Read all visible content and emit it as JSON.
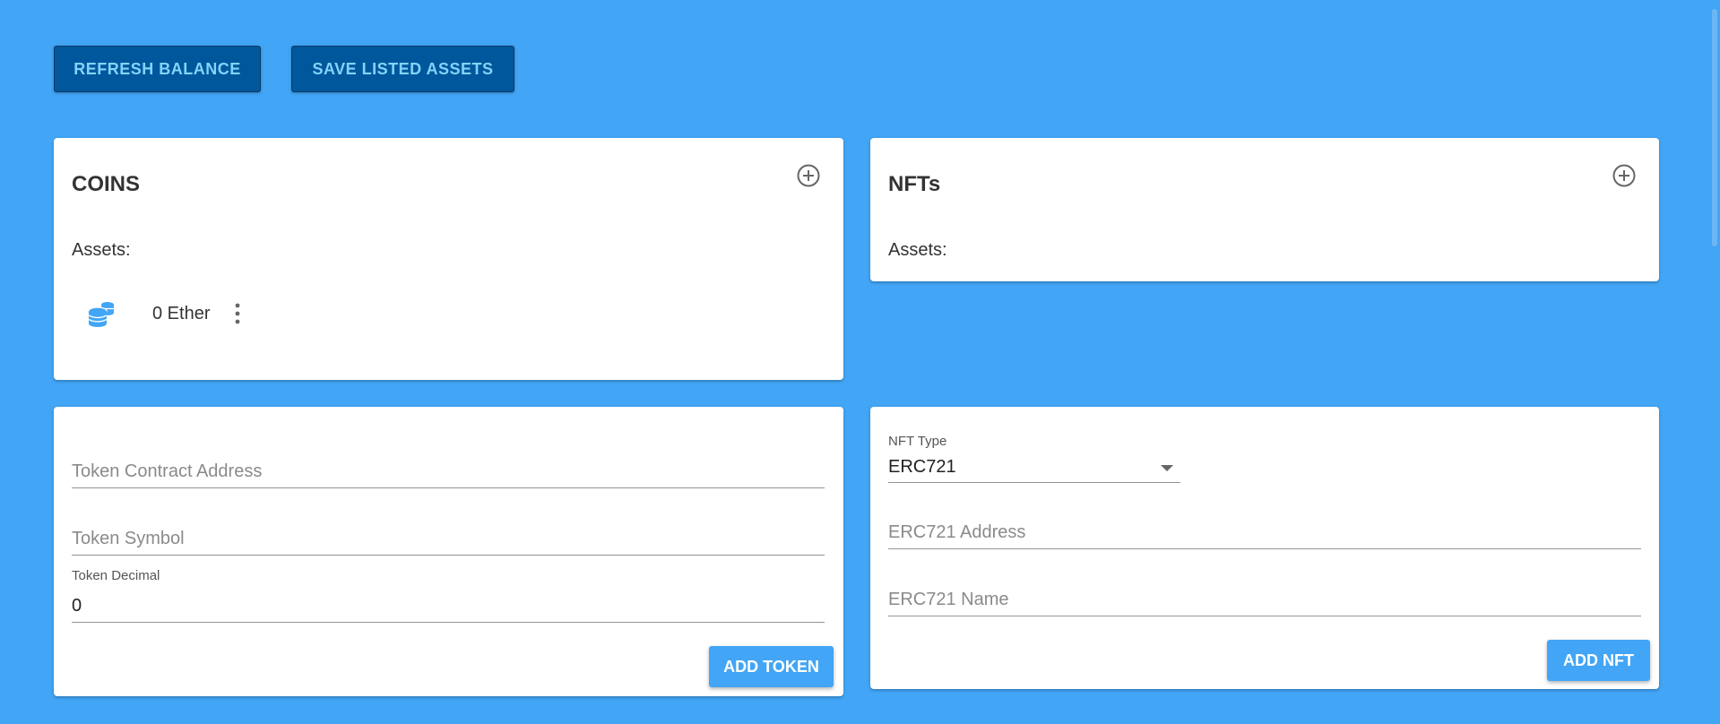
{
  "toolbar": {
    "refresh_label": "REFRESH BALANCE",
    "save_label": "SAVE LISTED ASSETS"
  },
  "coins_card": {
    "title": "COINS",
    "add_icon": "add-circle-icon",
    "assets_label": "Assets:",
    "items": [
      {
        "icon": "coins-icon",
        "text": "0 Ether",
        "menu_icon": "more-vert-icon"
      }
    ]
  },
  "nfts_card": {
    "title": "NFTs",
    "add_icon": "add-circle-icon",
    "assets_label": "Assets:"
  },
  "token_form": {
    "contract_address": {
      "placeholder": "Token Contract Address",
      "value": ""
    },
    "symbol": {
      "placeholder": "Token Symbol",
      "value": ""
    },
    "decimal": {
      "label": "Token Decimal",
      "value": "0"
    },
    "add_button": "ADD TOKEN"
  },
  "nft_form": {
    "type": {
      "label": "NFT Type",
      "value": "ERC721"
    },
    "address": {
      "placeholder": "ERC721 Address",
      "value": ""
    },
    "name": {
      "placeholder": "ERC721 Name",
      "value": ""
    },
    "add_button": "ADD NFT"
  },
  "colors": {
    "background": "#42a5f5",
    "toolbar_button_bg": "#01579b",
    "toolbar_button_text": "#81d4fa",
    "accent": "#42a5f5",
    "card": "#ffffff"
  }
}
